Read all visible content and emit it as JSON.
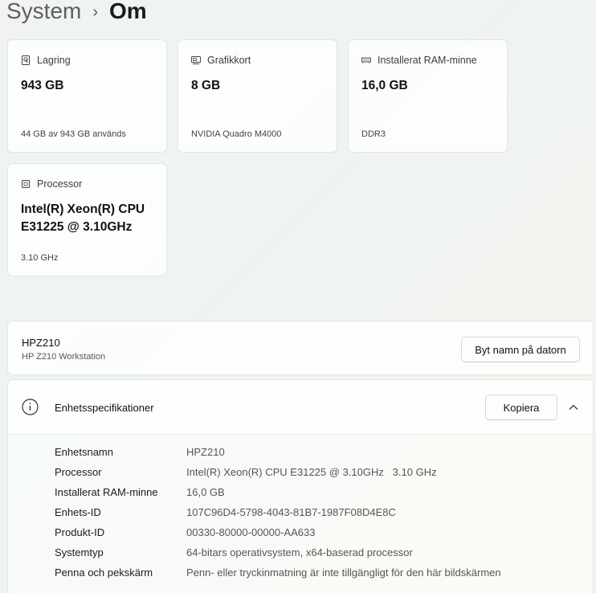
{
  "breadcrumb": {
    "root": "System",
    "separator": "›",
    "current": "Om"
  },
  "cards": [
    {
      "icon": "storage-icon",
      "label": "Lagring",
      "value": "943 GB",
      "sub": "44 GB av 943 GB används"
    },
    {
      "icon": "graphics-card-icon",
      "label": "Grafikkort",
      "value": "8 GB",
      "sub": "NVIDIA Quadro M4000"
    },
    {
      "icon": "ram-icon",
      "label": "Installerat RAM-minne",
      "value": "16,0 GB",
      "sub": "DDR3"
    },
    {
      "icon": "processor-icon",
      "label": "Processor",
      "value": "Intel(R) Xeon(R) CPU E31225 @ 3.10GHz",
      "sub": "3.10 GHz"
    }
  ],
  "device": {
    "name": "HPZ210",
    "model": "HP Z210 Workstation",
    "rename_label": "Byt namn på datorn"
  },
  "specs": {
    "title": "Enhetsspecifikationer",
    "copy_label": "Kopiera",
    "rows": [
      {
        "label": "Enhetsnamn",
        "value": "HPZ210"
      },
      {
        "label": "Processor",
        "value": "Intel(R) Xeon(R) CPU E31225 @ 3.10GHz   3.10 GHz"
      },
      {
        "label": "Installerat RAM-minne",
        "value": "16,0 GB"
      },
      {
        "label": "Enhets-ID",
        "value": "107C96D4-5798-4043-81B7-1987F08D4E8C"
      },
      {
        "label": "Produkt-ID",
        "value": "00330-80000-00000-AA633"
      },
      {
        "label": "Systemtyp",
        "value": "64-bitars operativsystem, x64-baserad processor"
      },
      {
        "label": "Penna och pekskärm",
        "value": "Penn- eller tryckinmatning är inte tillgängligt för den här bildskärmen"
      }
    ]
  }
}
